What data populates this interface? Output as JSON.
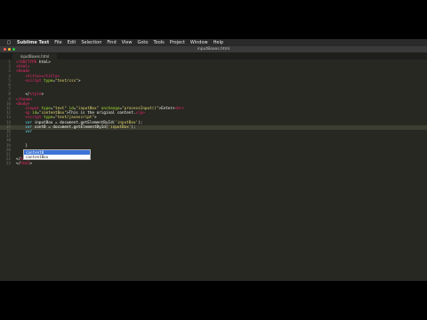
{
  "menubar": {
    "apple_icon": "apple-icon",
    "app_name": "Sublime Text",
    "items": [
      "File",
      "Edit",
      "Selection",
      "Find",
      "View",
      "Goto",
      "Tools",
      "Project",
      "Window",
      "Help"
    ]
  },
  "window": {
    "title": "inputBoxes.html",
    "tab_label": "inputBoxes.html"
  },
  "editor": {
    "lines": [
      {
        "n": "1",
        "parts": [
          {
            "t": "<!",
            "c": "tag"
          },
          {
            "t": "DOCTYPE",
            "c": "tag"
          },
          {
            "t": " html>",
            "c": "txt"
          }
        ]
      },
      {
        "n": "2",
        "parts": [
          {
            "t": "<html>",
            "c": "tag"
          }
        ]
      },
      {
        "n": "3",
        "parts": [
          {
            "t": "<head>",
            "c": "tag"
          }
        ]
      },
      {
        "n": "4",
        "parts": [
          {
            "t": "    <title></title>",
            "c": "tag"
          }
        ]
      },
      {
        "n": "5",
        "parts": [
          {
            "t": "    <script ",
            "c": "tag"
          },
          {
            "t": "type",
            "c": "attr"
          },
          {
            "t": "=",
            "c": "txt"
          },
          {
            "t": "\"text/css\"",
            "c": "str"
          },
          {
            "t": ">",
            "c": "txt"
          }
        ]
      },
      {
        "n": "6",
        "parts": []
      },
      {
        "n": "7",
        "parts": []
      },
      {
        "n": "8",
        "parts": [
          {
            "t": "    </",
            "c": "txt"
          },
          {
            "t": "style",
            "c": "tag"
          },
          {
            "t": ">",
            "c": "txt"
          }
        ]
      },
      {
        "n": "9",
        "parts": [
          {
            "t": "</head>",
            "c": "tag"
          }
        ]
      },
      {
        "n": "10",
        "parts": [
          {
            "t": "<body>",
            "c": "tag"
          }
        ]
      },
      {
        "n": "11",
        "parts": [
          {
            "t": "    <input ",
            "c": "tag"
          },
          {
            "t": "type",
            "c": "attr"
          },
          {
            "t": "=",
            "c": "txt"
          },
          {
            "t": "\"text\"",
            "c": "str"
          },
          {
            "t": " id",
            "c": "attr"
          },
          {
            "t": "=",
            "c": "txt"
          },
          {
            "t": "\"inputBox\"",
            "c": "str"
          },
          {
            "t": " onchange",
            "c": "attr"
          },
          {
            "t": "=",
            "c": "txt"
          },
          {
            "t": "\"processInput()\"",
            "c": "str"
          },
          {
            "t": ">Enter>",
            "c": "txt"
          },
          {
            "t": "<br>",
            "c": "tag"
          }
        ]
      },
      {
        "n": "12",
        "parts": [
          {
            "t": "    <p ",
            "c": "tag"
          },
          {
            "t": "id",
            "c": "attr"
          },
          {
            "t": "=",
            "c": "txt"
          },
          {
            "t": "\"contentBox\"",
            "c": "str"
          },
          {
            "t": ">This is the original content.",
            "c": "txt"
          },
          {
            "t": "</p>",
            "c": "tag"
          }
        ]
      },
      {
        "n": "13",
        "parts": [
          {
            "t": "    <script ",
            "c": "tag"
          },
          {
            "t": "type",
            "c": "attr"
          },
          {
            "t": "=",
            "c": "txt"
          },
          {
            "t": "\"text/javascript\"",
            "c": "str"
          },
          {
            "t": ">",
            "c": "txt"
          }
        ]
      },
      {
        "n": "14",
        "parts": [
          {
            "t": "    var ",
            "c": "kw"
          },
          {
            "t": "inputBox = document.getElementById(",
            "c": "txt"
          },
          {
            "t": "'inputBox'",
            "c": "str"
          },
          {
            "t": ");",
            "c": "txt"
          }
        ]
      },
      {
        "n": "15",
        "parts": [
          {
            "t": "    var ",
            "c": "kw"
          },
          {
            "t": "contB = document.getElementById(",
            "c": "txt"
          },
          {
            "t": "'inputBox'",
            "c": "str"
          },
          {
            "t": ");",
            "c": "txt"
          }
        ],
        "active": true
      },
      {
        "n": "16",
        "parts": [
          {
            "t": "    var ",
            "c": "kw"
          }
        ]
      },
      {
        "n": "17",
        "parts": []
      },
      {
        "n": "18",
        "parts": []
      },
      {
        "n": "19",
        "parts": [
          {
            "t": "    }",
            "c": "txt"
          }
        ]
      },
      {
        "n": "20",
        "parts": []
      },
      {
        "n": "21",
        "parts": [
          {
            "t": "    </",
            "c": "txt"
          },
          {
            "t": "script",
            "c": "tag"
          },
          {
            "t": ">",
            "c": "txt"
          }
        ]
      },
      {
        "n": "22",
        "parts": [
          {
            "t": "</",
            "c": "txt"
          },
          {
            "t": "body",
            "c": "tag"
          },
          {
            "t": ">",
            "c": "txt"
          }
        ]
      },
      {
        "n": "23",
        "parts": [
          {
            "t": "</",
            "c": "txt"
          },
          {
            "t": "html",
            "c": "tag"
          },
          {
            "t": ">",
            "c": "txt"
          }
        ]
      }
    ]
  },
  "autocomplete": {
    "options": [
      "contentB",
      "contentBox"
    ],
    "selected_index": 0
  },
  "colors": {
    "background": "#272822",
    "tag": "#f92672",
    "attribute": "#a6e22e",
    "string": "#e6db74",
    "keyword": "#66d9ef",
    "selection": "#3b73d6"
  }
}
